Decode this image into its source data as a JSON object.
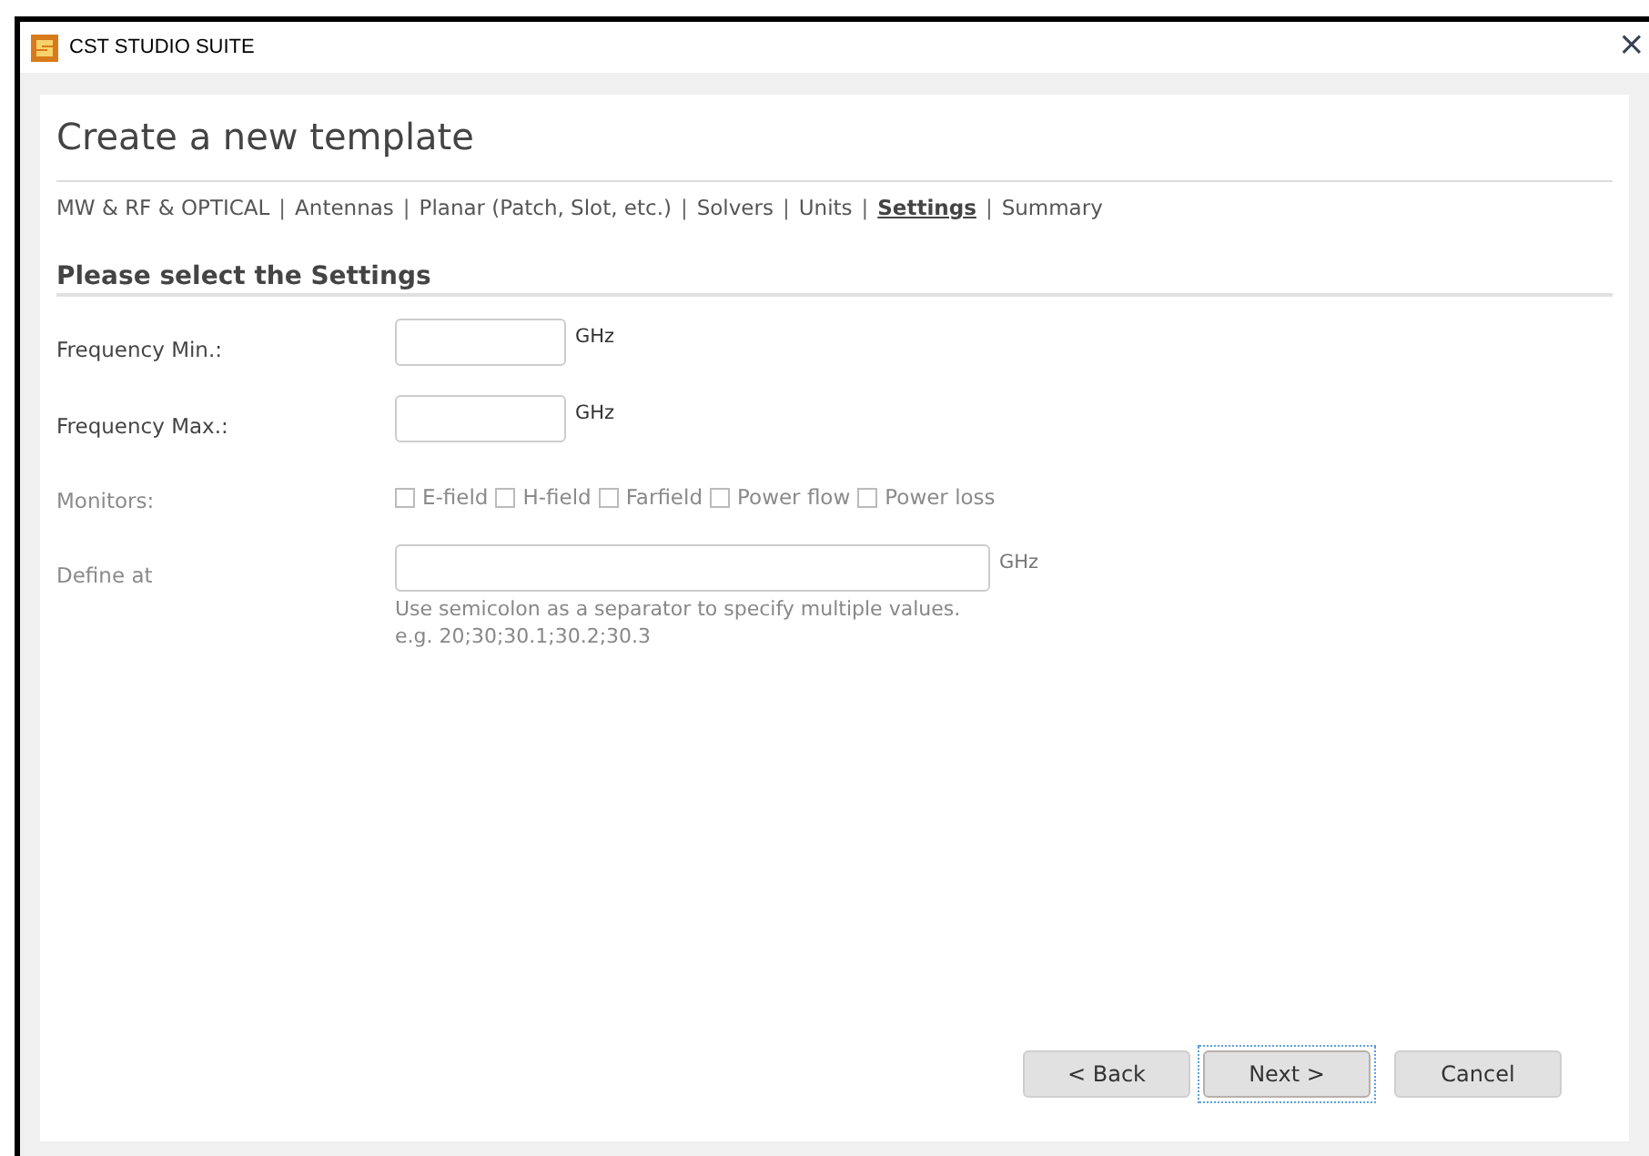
{
  "window": {
    "title": "CST STUDIO SUITE",
    "close": "×"
  },
  "heading": "Create a new template",
  "breadcrumb_separator": "|",
  "breadcrumbs": [
    {
      "label": "MW & RF & OPTICAL",
      "selected": false
    },
    {
      "label": "Antennas",
      "selected": false
    },
    {
      "label": "Planar (Patch, Slot, etc.)",
      "selected": false
    },
    {
      "label": "Solvers",
      "selected": false
    },
    {
      "label": "Units",
      "selected": false
    },
    {
      "label": "Settings",
      "selected": true
    },
    {
      "label": "Summary",
      "selected": false
    }
  ],
  "section_title": "Please select the Settings",
  "rows": [
    {
      "kind": "field",
      "label": "Frequency Min.:",
      "disabled": false,
      "wide": false,
      "unit": "GHz"
    },
    {
      "kind": "field",
      "label": "Frequency Max.:",
      "disabled": false,
      "wide": false,
      "unit": "GHz"
    },
    {
      "kind": "checks",
      "label": "Monitors:",
      "disabled": true,
      "options": [
        {
          "label": "E-field",
          "checked": false
        },
        {
          "label": "H-field",
          "checked": false
        },
        {
          "label": "Farfield",
          "checked": false
        },
        {
          "label": "Power flow",
          "checked": false
        },
        {
          "label": "Power loss",
          "checked": false
        }
      ]
    },
    {
      "kind": "field",
      "label": "Define at",
      "disabled": true,
      "wide": true,
      "unit": "GHz",
      "hint": [
        "Use semicolon as a separator to specify multiple values.",
        "e.g. 20;30;30.1;30.2;30.3"
      ]
    }
  ],
  "buttons": [
    {
      "label": "< Back",
      "focused": false
    },
    {
      "label": "Next >",
      "focused": true
    },
    {
      "label": "Cancel",
      "focused": false
    }
  ]
}
